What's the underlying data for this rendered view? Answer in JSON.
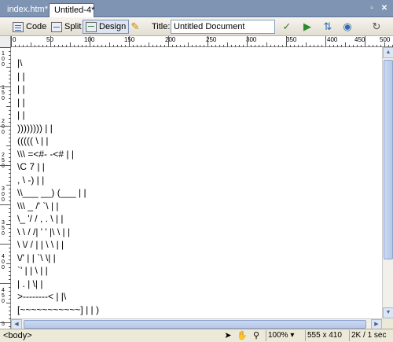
{
  "tabs": [
    {
      "label": "index.htm*",
      "active": false
    },
    {
      "label": "Untitled-4*",
      "active": true
    }
  ],
  "window_buttons": {
    "restore": "▫",
    "close": "✕"
  },
  "toolbar": {
    "code_label": "Code",
    "split_label": "Split",
    "design_label": "Design",
    "title_label": "Title:",
    "title_value": "Untitled Document"
  },
  "ruler": {
    "top_labels": [
      "0",
      "50",
      "100",
      "150",
      "200",
      "250",
      "300",
      "350",
      "400",
      "450",
      "500"
    ],
    "left_labels": [
      "1 0 0",
      "1 5 0",
      "2 0 0",
      "2 5 0",
      "3 0 0",
      "3 5 0",
      "4 0 0",
      "4 5 0",
      "5"
    ]
  },
  "document": {
    "lines": [
      "|\\",
      "| |",
      "| |",
      "| |",
      "| |",
      ")))))))) | |",
      "((((( \\ | |",
      "\\\\\\ =<#- -<# | |",
      "\\C 7 | |",
      ", \\ -) | |",
      "\\\\___ __) (___ | |",
      "\\\\\\ _ /' `\\ | |",
      "\\_ '/ / , . \\ | |",
      "\\ \\ / /| ' ' |\\ \\ | |",
      "\\ \\/ / | | \\ \\ | |",
      "\\/' | | `\\ \\| |",
      "`' | | \\ | |",
      "| . | \\| |",
      ">--------< | |\\",
      "[~~~~~~~~~~~] | | )"
    ]
  },
  "status": {
    "tag_selector": "<body>",
    "zoom": "100%",
    "window_size": "555 x 410",
    "download": "2K / 1 sec"
  },
  "colors": {
    "tab_bar": "#7f93b2",
    "toolbar": "#ece9d8",
    "scroll_thumb": "#b7c8e8"
  }
}
